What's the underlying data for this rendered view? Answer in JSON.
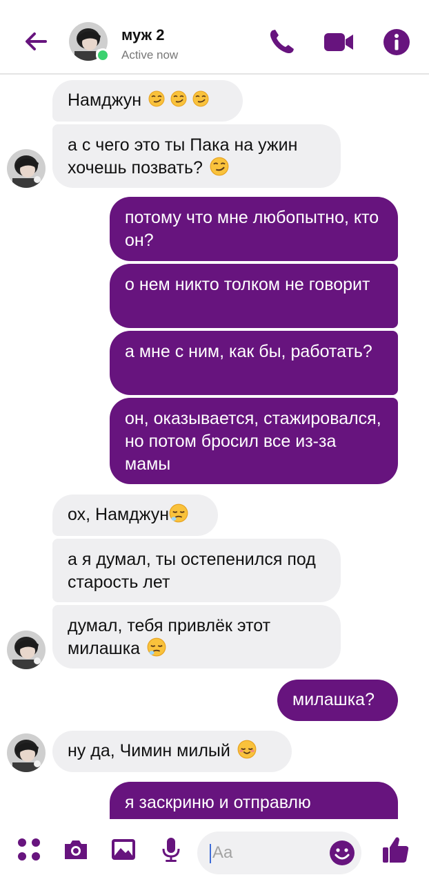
{
  "header": {
    "contact_name": "муж 2",
    "status": "Active now"
  },
  "messages": [
    {
      "dir": "in",
      "text": "Намджун",
      "emoji": [
        "smirk",
        "smirk",
        "smirk"
      ]
    },
    {
      "dir": "in",
      "text": "а с чего это ты Пака на ужин хочешь позвать?",
      "emoji": [
        "smirk"
      ]
    },
    {
      "dir": "out",
      "text": "потому что мне любопытно, кто он?"
    },
    {
      "dir": "out",
      "text": "о нем никто толком не говорит"
    },
    {
      "dir": "out",
      "text": "а мне с ним, как бы, работать?"
    },
    {
      "dir": "out",
      "text": "он, оказывается, стажировался, но потом бросил все из-за мамы"
    },
    {
      "dir": "in",
      "text": "ох, Намджун",
      "emoji": [
        "sleepy"
      ]
    },
    {
      "dir": "in",
      "text": "а я думал, ты остепенился под старость лет"
    },
    {
      "dir": "in",
      "text": "думал, тебя привлёк этот милашка",
      "emoji": [
        "sleepy"
      ]
    },
    {
      "dir": "out",
      "text": "милашка?"
    },
    {
      "dir": "in",
      "text": "ну да, Чимин милый",
      "emoji": [
        "relieved"
      ]
    },
    {
      "dir": "out",
      "text": "я заскриню и отправлю"
    }
  ],
  "composer": {
    "placeholder": "Aa"
  },
  "icons": {
    "back": "arrow-left-icon",
    "call": "phone-icon",
    "video": "video-camera-icon",
    "info": "info-icon",
    "apps": "four-dots-icon",
    "camera": "camera-icon",
    "gallery": "image-icon",
    "voice": "microphone-icon",
    "emoji": "smiley-icon",
    "like": "thumbs-up-icon"
  },
  "colors": {
    "accent": "#67147e",
    "incoming_bubble": "#efeff1",
    "online": "#3bd16f"
  }
}
